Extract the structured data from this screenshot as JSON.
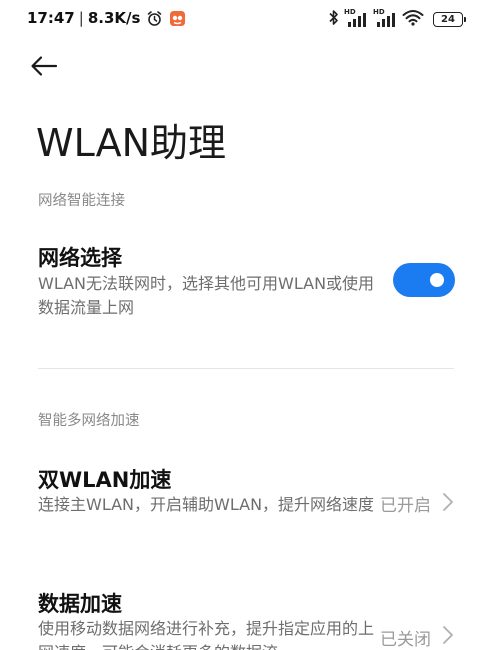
{
  "status_bar": {
    "time": "17:47",
    "separator": "|",
    "speed": "8.3K/s",
    "alarm_icon": "alarm-clock-icon",
    "app_icon": "app-notification-icon",
    "bluetooth_icon": "bluetooth-icon",
    "signal1_label": "HD",
    "signal2_label": "HD",
    "wifi_icon": "wifi-icon",
    "battery": "24"
  },
  "header": {
    "back_icon": "back-arrow-icon",
    "title": "WLAN助理"
  },
  "sections": [
    {
      "header": "网络智能连接",
      "items": [
        {
          "title": "网络选择",
          "description": "WLAN无法联网时，选择其他可用WLAN或使用数据流量上网",
          "control": "toggle",
          "toggle_on": true
        }
      ]
    },
    {
      "header": "智能多网络加速",
      "items": [
        {
          "title": "双WLAN加速",
          "description": "连接主WLAN，开启辅助WLAN，提升网络速度",
          "status": "已开启"
        },
        {
          "title": "数据加速",
          "description": "使用移动数据网络进行补充，提升指定应用的上网速度，可能会消耗更多的数据流",
          "status": "已关闭"
        }
      ]
    }
  ],
  "colors": {
    "accent": "#1a7cf0",
    "secondary_text": "#6e6e6e",
    "section_header": "#8a8a8a"
  }
}
